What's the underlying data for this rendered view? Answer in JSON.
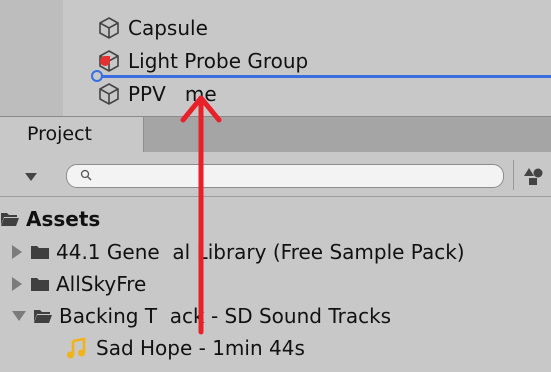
{
  "hierarchy": {
    "items": [
      {
        "label": "Capsule",
        "icon": "cube-icon"
      },
      {
        "label": "Light Probe Group",
        "icon": "cube-icon"
      },
      {
        "label": "PPV   me",
        "icon": "cube-icon"
      }
    ],
    "drop_indicator_color": "#3a6de0"
  },
  "project_panel": {
    "tab_label": "Project",
    "search_placeholder": ""
  },
  "tree": {
    "root": "Assets",
    "items": [
      {
        "label": "44.1 Gene  al Library (Free Sample Pack)",
        "expanded": false
      },
      {
        "label": "AllSkyFre",
        "expanded": false
      },
      {
        "label": "Backing T  ack - SD Sound Tracks",
        "expanded": true
      },
      {
        "label": "Sad Hope - 1min 44s",
        "icon": "music-note-icon"
      }
    ]
  },
  "colors": {
    "annotation_arrow": "#e8202a",
    "panel_bg": "#c8c8c8",
    "tab_bar_bg": "#a5a5a5"
  }
}
